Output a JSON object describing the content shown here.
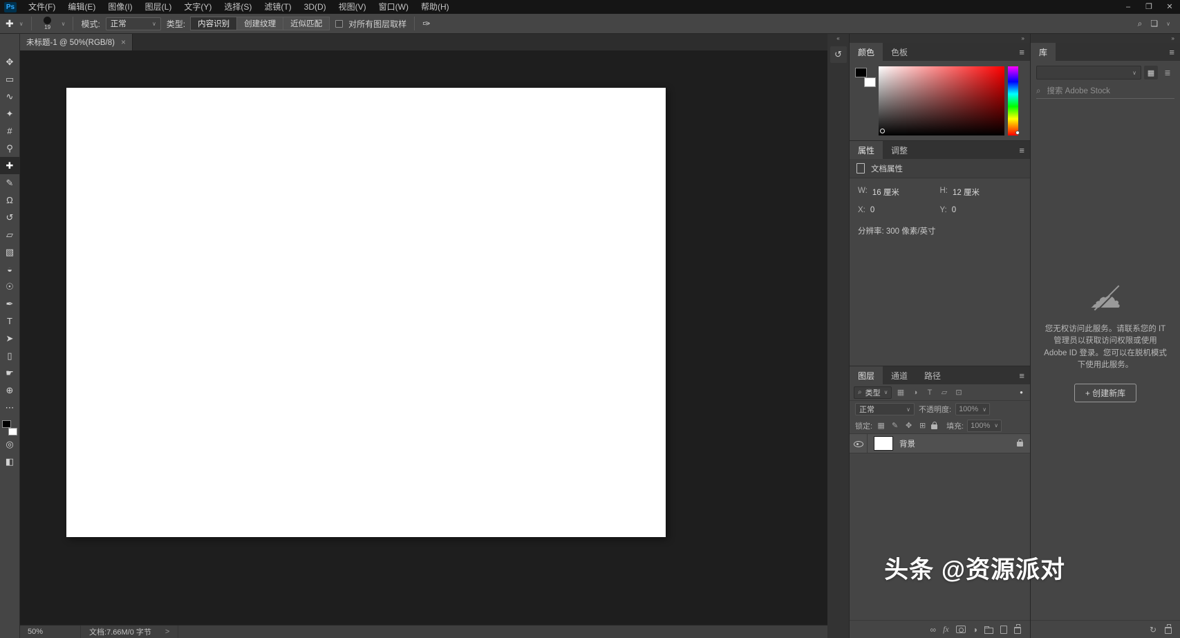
{
  "app": {
    "logo": "Ps"
  },
  "menubar": {
    "items": [
      "文件(F)",
      "编辑(E)",
      "图像(I)",
      "图层(L)",
      "文字(Y)",
      "选择(S)",
      "滤镜(T)",
      "3D(D)",
      "视图(V)",
      "窗口(W)",
      "帮助(H)"
    ],
    "window_controls": {
      "minimize": "–",
      "maximize": "❐",
      "close": "✕"
    }
  },
  "options_bar": {
    "tool_icon": "✚",
    "brush_size": "19",
    "mode_label": "模式:",
    "mode_value": "正常",
    "type_label": "类型:",
    "type_buttons": [
      "内容识别",
      "创建纹理",
      "近似匹配"
    ],
    "selected_type": "内容识别",
    "sample_all_layers": "对所有图层取样",
    "sample_all_layers_checked": false,
    "pen_pressure_icon": "✑",
    "workspace_icon": "❏"
  },
  "toolbar": {
    "tools": [
      {
        "name": "move-tool",
        "glyph": "✥"
      },
      {
        "name": "rectangular-marquee-tool",
        "glyph": "▭"
      },
      {
        "name": "lasso-tool",
        "glyph": "∿"
      },
      {
        "name": "quick-selection-tool",
        "glyph": "✦"
      },
      {
        "name": "crop-tool",
        "glyph": "#"
      },
      {
        "name": "eyedropper-tool",
        "glyph": "⚲"
      },
      {
        "name": "spot-healing-brush-tool",
        "glyph": "✚",
        "selected": true
      },
      {
        "name": "brush-tool",
        "glyph": "✎"
      },
      {
        "name": "clone-stamp-tool",
        "glyph": "Ω"
      },
      {
        "name": "history-brush-tool",
        "glyph": "↺"
      },
      {
        "name": "eraser-tool",
        "glyph": "▱"
      },
      {
        "name": "gradient-tool",
        "glyph": "▧"
      },
      {
        "name": "blur-tool",
        "glyph": "◒"
      },
      {
        "name": "dodge-tool",
        "glyph": "☉"
      },
      {
        "name": "pen-tool",
        "glyph": "✒"
      },
      {
        "name": "type-tool",
        "glyph": "T"
      },
      {
        "name": "path-selection-tool",
        "glyph": "➤"
      },
      {
        "name": "rectangle-tool",
        "glyph": "▯"
      },
      {
        "name": "hand-tool",
        "glyph": "☛"
      },
      {
        "name": "zoom-tool",
        "glyph": "⊕"
      },
      {
        "name": "edit-toolbar",
        "glyph": "⋯"
      }
    ],
    "quick_mask_glyph": "◎",
    "screen_mode_glyph": "◧",
    "foreground_color": "#000000",
    "background_color": "#ffffff"
  },
  "document": {
    "tab_title": "未标题-1 @ 50%(RGB/8)",
    "close_glyph": "×"
  },
  "status_bar": {
    "zoom": "50%",
    "info": "文档:7.66M/0 字节",
    "chevron": ">"
  },
  "color_panel": {
    "tabs": [
      "颜色",
      "色板"
    ],
    "foreground": "#000000",
    "background": "#ffffff",
    "hue_strip": [
      "#ff00ff",
      "#0000ff",
      "#00ffff",
      "#00ff00",
      "#ffff00",
      "#ff8000",
      "#ff0000"
    ],
    "field_hue": "#ff0000"
  },
  "properties_panel": {
    "tabs": [
      "属性",
      "调整"
    ],
    "section": "文档属性",
    "w_label": "W:",
    "w_value": "16 厘米",
    "h_label": "H:",
    "h_value": "12 厘米",
    "x_label": "X:",
    "x_value": "0",
    "y_label": "Y:",
    "y_value": "0",
    "resolution_text": "分辨率: 300 像素/英寸"
  },
  "layers_panel": {
    "tabs": [
      "图层",
      "通道",
      "路径"
    ],
    "filter_type_label": "类型",
    "filter_icons": [
      {
        "name": "pixel-layer-filter-icon",
        "glyph": "▦"
      },
      {
        "name": "adjustment-layer-filter-icon",
        "glyph": "◑"
      },
      {
        "name": "type-layer-filter-icon",
        "glyph": "T"
      },
      {
        "name": "shape-layer-filter-icon",
        "glyph": "▱"
      },
      {
        "name": "smart-object-filter-icon",
        "glyph": "⊡"
      }
    ],
    "filter_toggle_glyph": "●",
    "blend_mode": "正常",
    "opacity_label": "不透明度:",
    "opacity_value": "100%",
    "lock_label": "锁定:",
    "lock_icons": [
      {
        "name": "lock-transparent-pixels-icon",
        "glyph": "▦"
      },
      {
        "name": "lock-image-pixels-icon",
        "glyph": "✎"
      },
      {
        "name": "lock-position-icon",
        "glyph": "✥"
      },
      {
        "name": "lock-artboard-icon",
        "glyph": "⊞"
      }
    ],
    "fill_label": "填充:",
    "fill_value": "100%",
    "background_layer": {
      "name": "背景",
      "visible": true,
      "locked": true
    },
    "bottom_icons": [
      {
        "name": "link-layers-icon",
        "glyph": "∞"
      },
      {
        "name": "add-layer-style-icon",
        "glyph": "fx"
      },
      {
        "name": "add-layer-mask-icon",
        "glyph": ""
      },
      {
        "name": "new-adjustment-layer-icon",
        "glyph": "◑"
      },
      {
        "name": "new-group-icon",
        "glyph": ""
      },
      {
        "name": "new-layer-icon",
        "glyph": ""
      },
      {
        "name": "delete-layer-icon",
        "glyph": ""
      }
    ]
  },
  "libraries_panel": {
    "tab": "库",
    "search_placeholder": "搜索 Adobe Stock",
    "offline_message": "您无权访问此服务。请联系您的 IT 管理员以获取访问权限或使用 Adobe ID 登录。您可以在脱机模式下使用此服务。",
    "create_library_button": "+ 创建新库"
  },
  "watermark": {
    "text": "头条 @资源派对"
  },
  "icons": {
    "panel_menu": "≡",
    "collapse_chevron": "»",
    "expand_chevron": "«",
    "dropdown_arrow": "∨",
    "search": "⌕",
    "cloud": "☁",
    "history": "↺",
    "grid_view": "▦",
    "list_view": "≣",
    "sync": "↻"
  },
  "colors": {
    "menubar_bg": "#151515",
    "panel_bg": "#454545",
    "panel_header_bg": "#323232",
    "canvas_bg": "#1e1e1e",
    "document_bg": "#ffffff",
    "logo_blue": "#31a8ff",
    "selected_layer_bg": "#505050"
  }
}
